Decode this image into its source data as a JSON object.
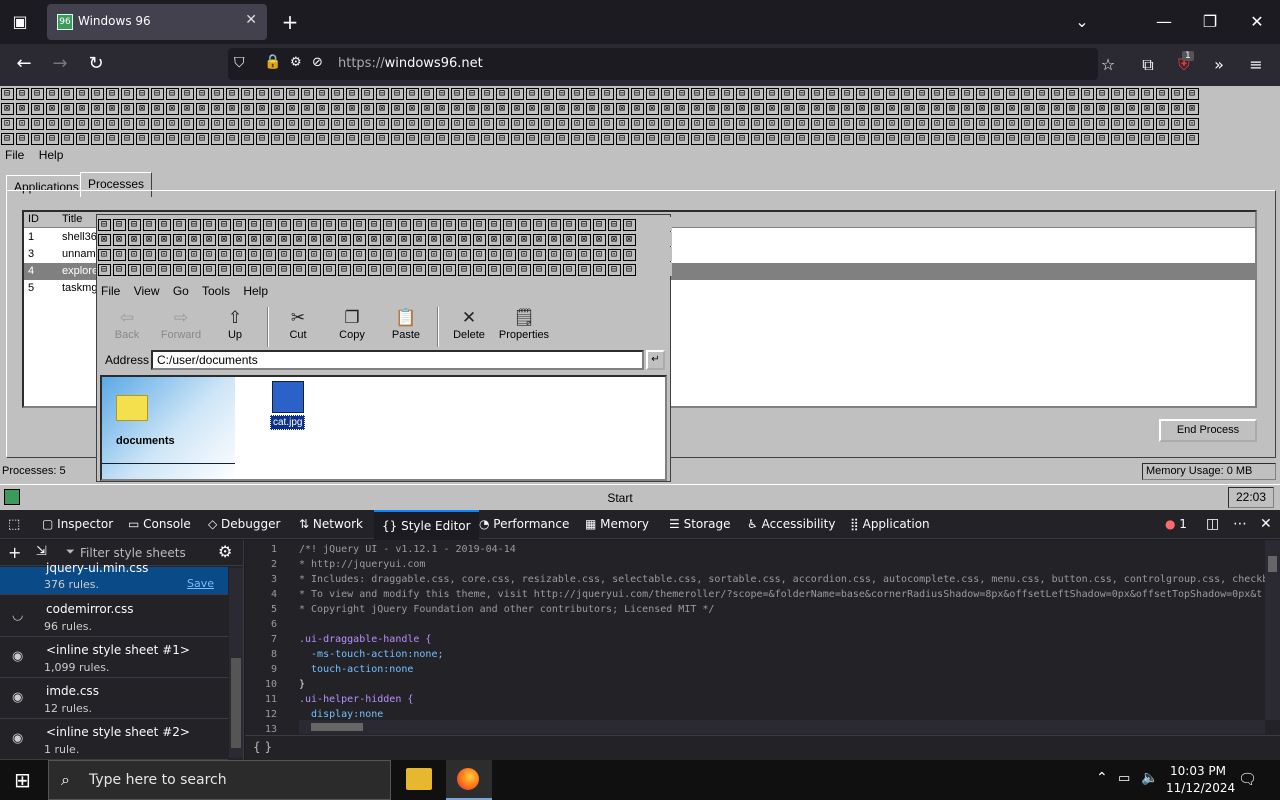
{
  "browser": {
    "tab_title": "Windows 96",
    "url_prefix": "https://",
    "url_host": "windows96.net",
    "extension_badge": "1"
  },
  "win96": {
    "toolbar_rows": [
      "⊟",
      "⊠",
      "⊡",
      "⊟"
    ],
    "menu": [
      "File",
      "Help"
    ],
    "tabs": [
      "Applications",
      "Processes"
    ],
    "list_headers": [
      "ID",
      "Title"
    ],
    "processes": [
      {
        "id": "1",
        "title": "shell36"
      },
      {
        "id": "3",
        "title": "unnam"
      },
      {
        "id": "4",
        "title": "explore"
      },
      {
        "id": "5",
        "title": "taskmg"
      }
    ],
    "end_process": "End Process",
    "status_left": "Processes: 5",
    "status_right": "Memory Usage: 0 MB",
    "start_label": "Start",
    "clock": "22:03"
  },
  "explorer": {
    "menu": [
      "File",
      "View",
      "Go",
      "Tools",
      "Help"
    ],
    "tools": [
      {
        "label": "Back",
        "icon": "back-arrow-icon",
        "glyph": "⇦"
      },
      {
        "label": "Forward",
        "icon": "forward-arrow-icon",
        "glyph": "⇨"
      },
      {
        "label": "Up",
        "icon": "up-folder-icon",
        "glyph": "⇧"
      },
      {
        "label": "Cut",
        "icon": "scissors-icon",
        "glyph": "✂"
      },
      {
        "label": "Copy",
        "icon": "copy-icon",
        "glyph": "❐"
      },
      {
        "label": "Paste",
        "icon": "paste-icon",
        "glyph": "📋"
      },
      {
        "label": "Delete",
        "icon": "delete-icon",
        "glyph": "✕"
      },
      {
        "label": "Properties",
        "icon": "properties-icon",
        "glyph": "🗒"
      }
    ],
    "address_label": "Address",
    "address_value": "C:/user/documents",
    "items": [
      {
        "label": "documents",
        "icon": "folder-icon"
      },
      {
        "label": "cat.jpg",
        "icon": "image-file-icon"
      }
    ]
  },
  "devtools": {
    "tabs": [
      "Inspector",
      "Console",
      "Debugger",
      "Network",
      "Style Editor",
      "Performance",
      "Memory",
      "Storage",
      "Accessibility",
      "Application"
    ],
    "active_tab": "Style Editor",
    "error_count": "1",
    "filter_placeholder": "Filter style sheets",
    "sheets": [
      {
        "name": "jquery-ui.min.css",
        "rules": "376 rules.",
        "save": "Save"
      },
      {
        "name": "codemirror.css",
        "rules": "96 rules."
      },
      {
        "name": "<inline style sheet #1>",
        "rules": "1,099 rules."
      },
      {
        "name": "imde.css",
        "rules": "12 rules."
      },
      {
        "name": "<inline style sheet #2>",
        "rules": "1 rule."
      }
    ],
    "code_lines": [
      "/*! jQuery UI - v1.12.1 - 2019-04-14",
      "* http://jqueryui.com",
      "* Includes: draggable.css, core.css, resizable.css, selectable.css, sortable.css, accordion.css, autocomplete.css, menu.css, button.css, controlgroup.css, checkb",
      "* To view and modify this theme, visit http://jqueryui.com/themeroller/?scope=&folderName=base&cornerRadiusShadow=8px&offsetLeftShadow=0px&offsetTopShadow=0px&t",
      "* Copyright jQuery Foundation and other contributors; Licensed MIT */",
      "",
      ".ui-draggable-handle {",
      "  -ms-touch-action:none;",
      "  touch-action:none",
      "}",
      ".ui-helper-hidden {",
      "  display:none",
      ""
    ],
    "status_text": "{ }"
  },
  "os_taskbar": {
    "search_placeholder": "Type here to search",
    "time": "10:03 PM",
    "date": "11/12/2024"
  }
}
